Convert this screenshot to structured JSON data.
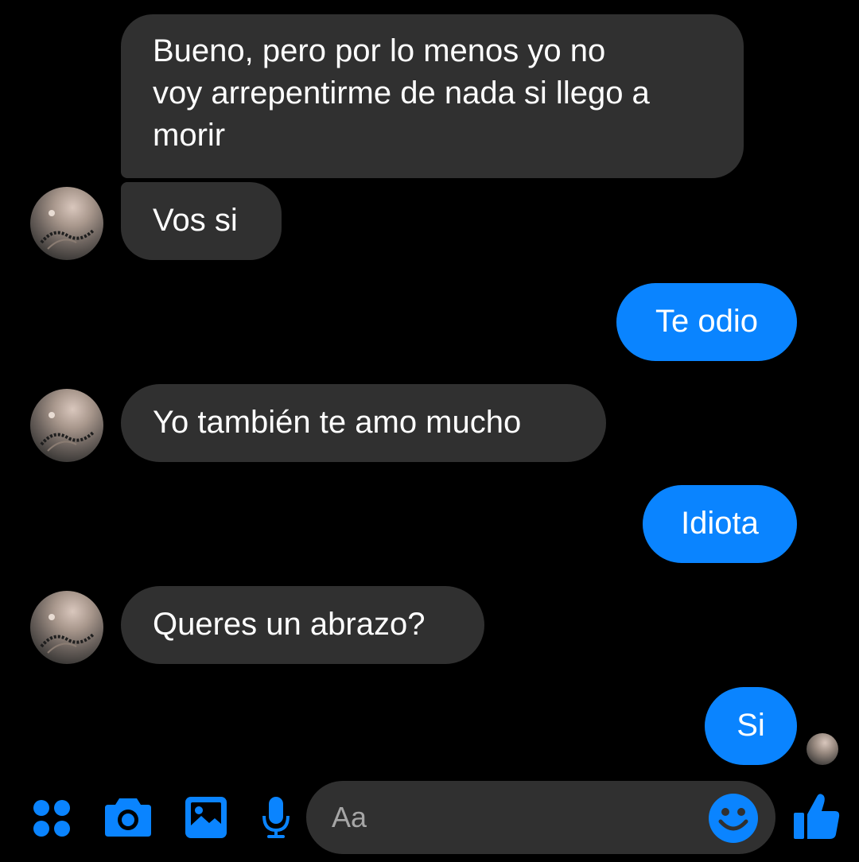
{
  "conversation": {
    "messages": [
      {
        "sender": "contact",
        "text": "Bueno, pero por lo menos yo no\nvoy arrepentirme de nada si llego a\nmorir"
      },
      {
        "sender": "contact",
        "text": "Vos si"
      },
      {
        "sender": "me",
        "text": "Te odio"
      },
      {
        "sender": "contact",
        "text": "Yo también te amo mucho"
      },
      {
        "sender": "me",
        "text": "Idiota"
      },
      {
        "sender": "contact",
        "text": "Queres un abrazo?"
      },
      {
        "sender": "me",
        "text": "Si"
      }
    ]
  },
  "composer": {
    "placeholder": "Aa",
    "buttons": [
      "apps-icon",
      "camera-icon",
      "gallery-icon",
      "microphone-icon",
      "emoji-icon",
      "thumbs-up-icon"
    ]
  },
  "colors": {
    "background": "#000000",
    "incoming_bubble": "#303030",
    "outgoing_bubble": "#0a84ff",
    "accent": "#0a84ff",
    "placeholder_text": "#a6a6a6"
  }
}
